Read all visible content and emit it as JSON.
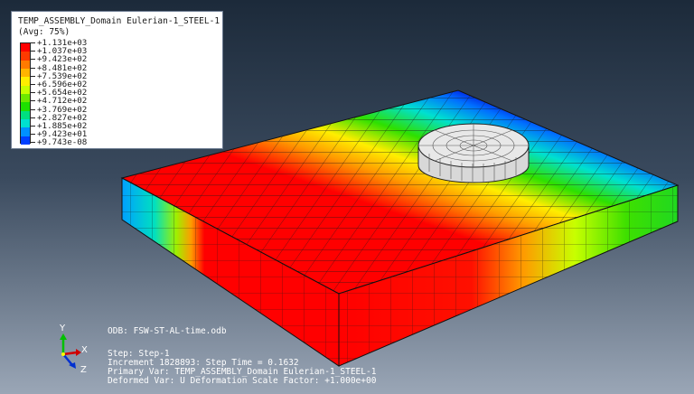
{
  "legend": {
    "title": "TEMP_ASSEMBLY_Domain Eulerian-1_STEEL-1",
    "subtitle": "(Avg: 75%)",
    "entries": [
      {
        "label": "+1.131e+03",
        "color": "#ff0000"
      },
      {
        "label": "+1.037e+03",
        "color": "#ff3a00"
      },
      {
        "label": "+9.423e+02",
        "color": "#ff7a00"
      },
      {
        "label": "+8.481e+02",
        "color": "#ffb400"
      },
      {
        "label": "+7.539e+02",
        "color": "#ffee00"
      },
      {
        "label": "+6.596e+02",
        "color": "#c8ff00"
      },
      {
        "label": "+5.654e+02",
        "color": "#6ee800"
      },
      {
        "label": "+4.712e+02",
        "color": "#1ee000"
      },
      {
        "label": "+3.769e+02",
        "color": "#00e080"
      },
      {
        "label": "+2.827e+02",
        "color": "#00e0d0"
      },
      {
        "label": "+1.885e+02",
        "color": "#0090ff"
      },
      {
        "label": "+9.423e+01",
        "color": "#0040ff"
      },
      {
        "label": "+9.743e-08",
        "color": "#0000d8"
      }
    ]
  },
  "info": {
    "odb": "ODB: FSW-ST-AL-time.odb",
    "step": "Step: Step-1",
    "increment": "Increment   1828893: Step Time =    0.1632",
    "primary_var": "Primary Var: TEMP_ASSEMBLY_Domain Eulerian-1_STEEL-1",
    "deformed_var": "Deformed Var: U   Deformation Scale Factor: +1.000e+00"
  },
  "triad": {
    "x": "X",
    "y": "Y",
    "z": "Z"
  }
}
